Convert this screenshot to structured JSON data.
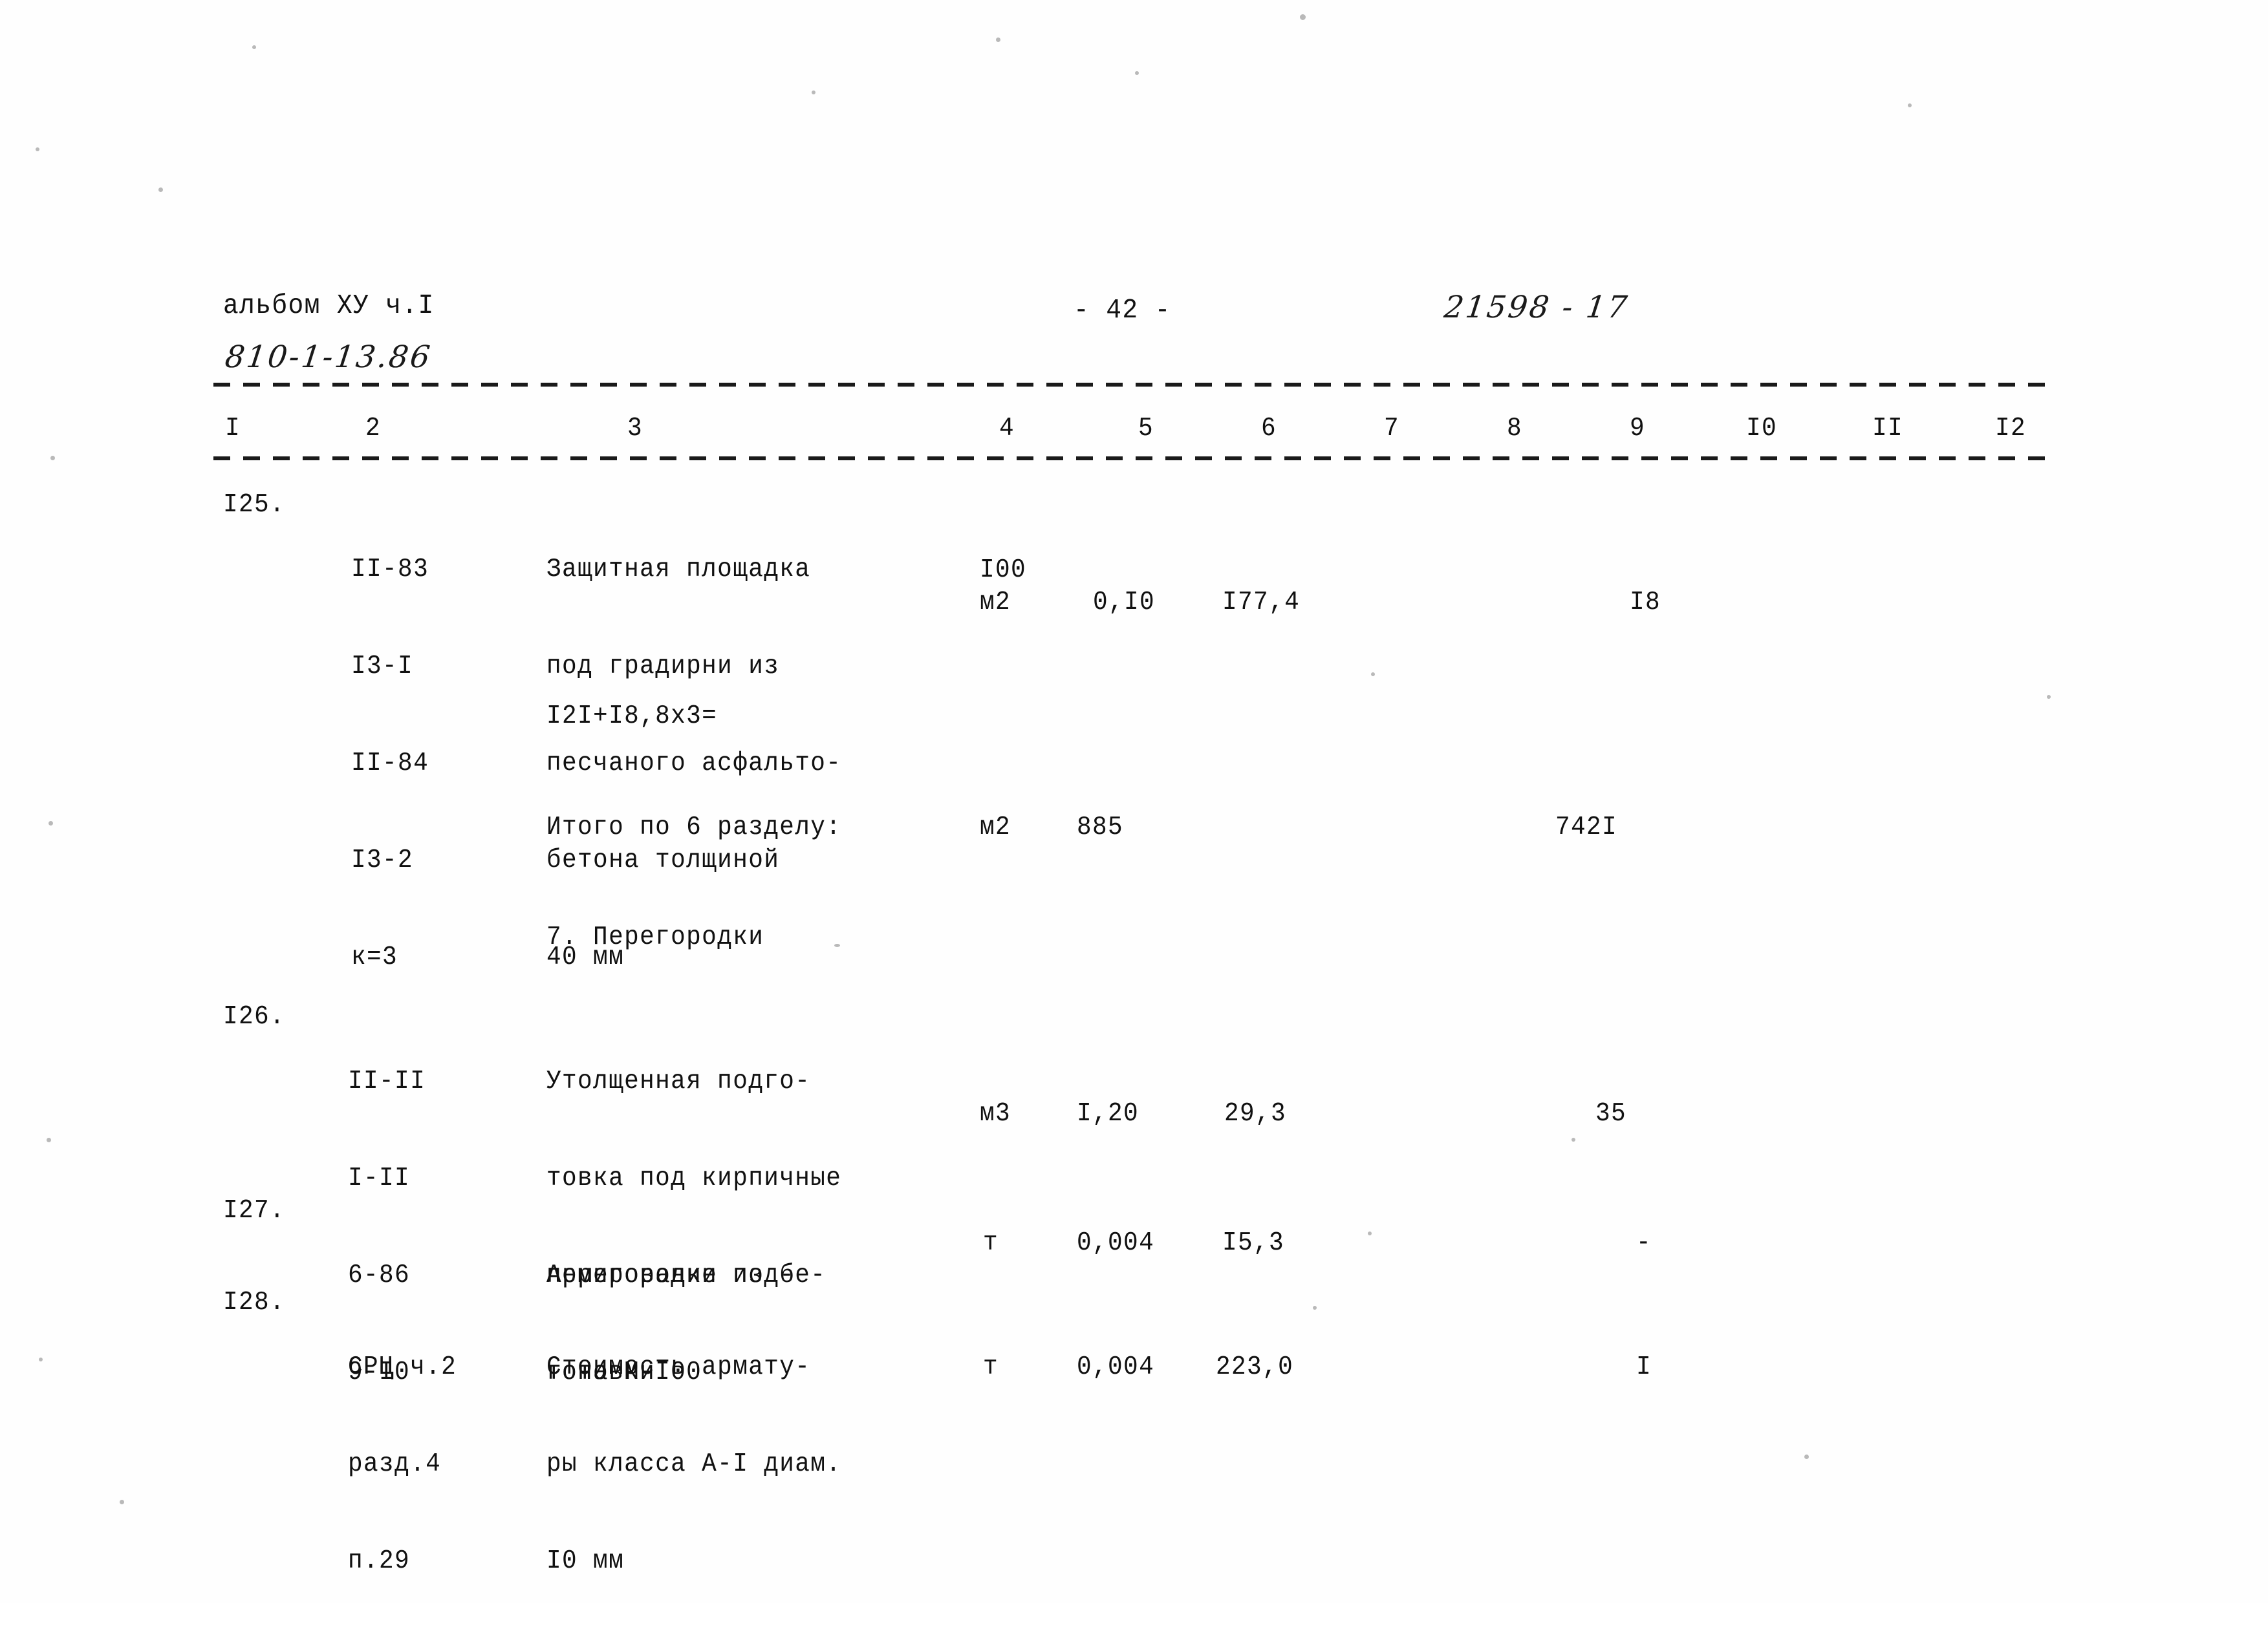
{
  "document": {
    "album_label": "альбом ХУ ч.I",
    "album_code_handwritten": "810-1-13.86",
    "page_number": "- 42 -",
    "doc_number_handwritten": "21598 - 17"
  },
  "table": {
    "column_headers": [
      "I",
      "2",
      "3",
      "4",
      "5",
      "6",
      "7",
      "8",
      "9",
      "I0",
      "II",
      "I2"
    ],
    "rows": [
      {
        "num": "I25.",
        "codes": [
          "II-83",
          "I3-I",
          "II-84",
          "I3-2",
          "к=3"
        ],
        "description": [
          "Защитная площадка",
          "под градирни из",
          "песчаного асфальто-",
          "бетона толщиной",
          "40 мм"
        ],
        "unit": [
          "I00",
          "м2"
        ],
        "col5": "0,I0",
        "col6": "I77,4",
        "col9": "I8"
      },
      {
        "formula": "I2I+I8,8x3="
      },
      {
        "description": [
          "Итого по 6 разделу:"
        ],
        "unit": [
          "м2"
        ],
        "col5": "885",
        "col9": "742I"
      },
      {
        "section_heading": "7. Перегородки"
      },
      {
        "num": "I26.",
        "codes": [
          "II-II",
          "I-II"
        ],
        "description": [
          "Утолщенная подго-",
          "товка под кирпичные",
          "перегородки из бе-",
          "тона М-I00"
        ],
        "unit": [
          "м3"
        ],
        "col5": "I,20",
        "col6": "29,3",
        "col9": "35"
      },
      {
        "num": "I27.",
        "codes": [
          "6-86",
          "9-I0"
        ],
        "description": [
          "Армирование под-",
          "готовки"
        ],
        "unit": [
          "т"
        ],
        "col5": "0,004",
        "col6": "I5,3",
        "col9": "-"
      },
      {
        "num": "I28.",
        "codes": [
          "СРЦ ч.2",
          "разд.4",
          "п.29"
        ],
        "description": [
          "Стоимость армату-",
          "ры класса А-I диам.",
          "I0 мм"
        ],
        "unit": [
          "т"
        ],
        "col5": "0,004",
        "col6": "223,0",
        "col9": "I"
      }
    ]
  },
  "colors": {
    "ink": "#141414",
    "paper": "#fefefe"
  }
}
